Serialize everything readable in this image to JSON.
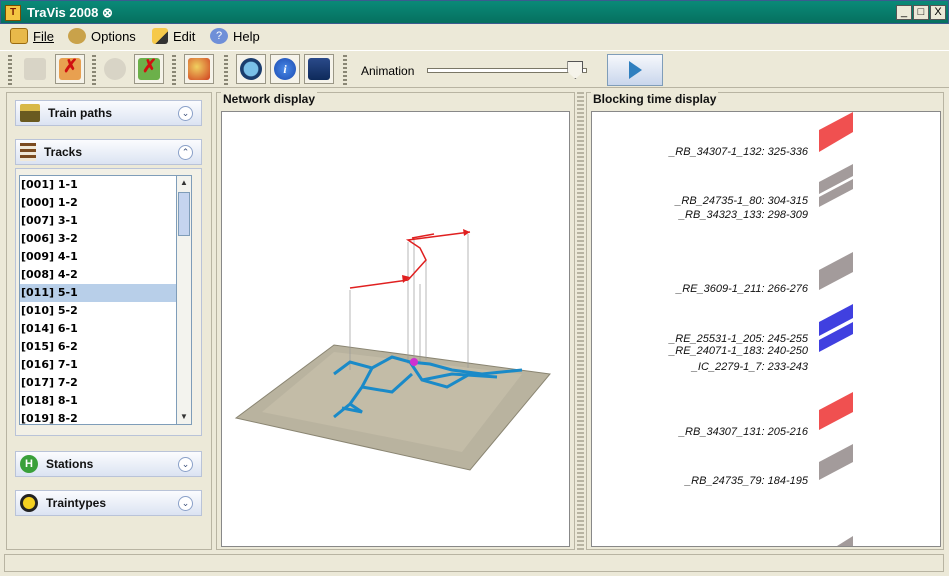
{
  "window": {
    "title": "TraVis 2008",
    "title_suffix": "⊗",
    "minimize": "_",
    "maximize": "□",
    "close": "X"
  },
  "menu": [
    {
      "label": "File",
      "icon": "folder-open-icon"
    },
    {
      "label": "Options",
      "icon": "options-icon"
    },
    {
      "label": "Edit",
      "icon": "pencil-icon"
    },
    {
      "label": "Help",
      "icon": "help-icon"
    }
  ],
  "toolbar": {
    "animation_label": "Animation",
    "animation_value": 0.95
  },
  "left": {
    "train_paths": "Train paths",
    "tracks": "Tracks",
    "stations": "Stations",
    "traintypes": "Traintypes",
    "track_items": [
      "[001] 1-1",
      "[000] 1-2",
      "[007] 3-1",
      "[006] 3-2",
      "[009] 4-1",
      "[008] 4-2",
      "[011] 5-1",
      "[010] 5-2",
      "[014] 6-1",
      "[015] 6-2",
      "[016] 7-1",
      "[017] 7-2",
      "[018] 8-1",
      "[019] 8-2"
    ],
    "selected_index": 6
  },
  "center": {
    "title": "Network display"
  },
  "right": {
    "title": "Blocking time display",
    "labels": [
      "_RB_34307-1_132: 325-336",
      "_RB_24735-1_80: 304-315",
      "_RB_34323_133: 298-309",
      "_RE_3609-1_211: 266-276",
      "_RE_25531-1_205: 245-255",
      "_RE_24071-1_183: 240-250",
      "_IC_2279-1_7: 233-243",
      "_RB_34307_131: 205-216",
      "_RB_24735_79: 184-195"
    ]
  },
  "colors": {
    "red_block": "#f05050",
    "grey_block": "#a39b9b",
    "blue_block": "#4040e0",
    "selection": "#b8cfe9"
  }
}
